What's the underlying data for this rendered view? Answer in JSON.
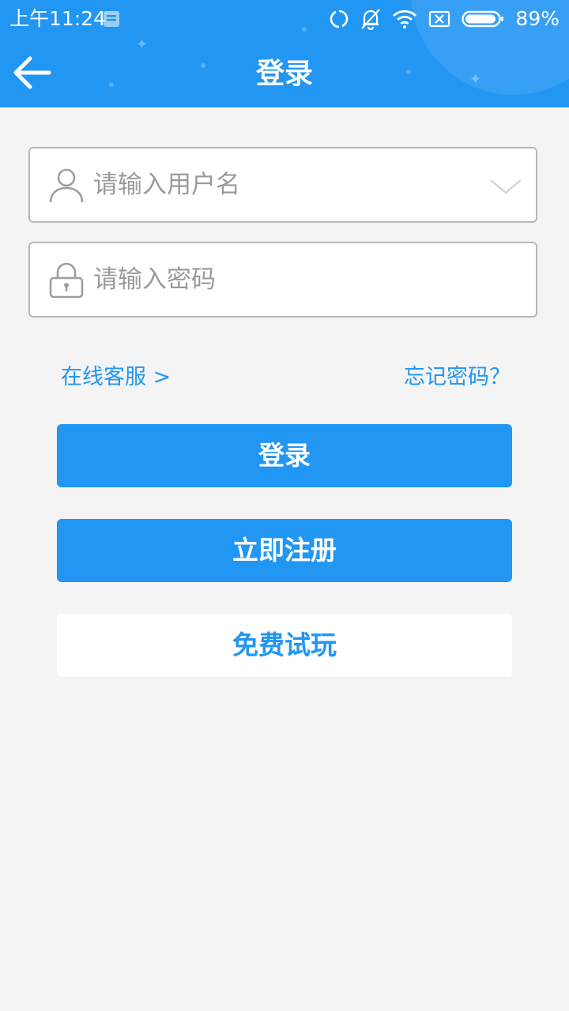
{
  "status_bar": {
    "time": "上午11:24",
    "battery": "89%"
  },
  "header": {
    "title": "登录"
  },
  "form": {
    "username_placeholder": "请输入用户名",
    "password_placeholder": "请输入密码"
  },
  "links": {
    "online_service": "在线客服 >",
    "forgot_password": "忘记密码？"
  },
  "buttons": {
    "login": "登录",
    "register": "立即注册",
    "free_trial": "免费试玩"
  },
  "colors": {
    "brand_blue": "#2196f3",
    "background": "#f4f4f5"
  },
  "icons": {
    "back": "arrow-left-icon",
    "user": "user-icon",
    "lock": "lock-icon",
    "dropdown": "chevron-down-icon"
  }
}
